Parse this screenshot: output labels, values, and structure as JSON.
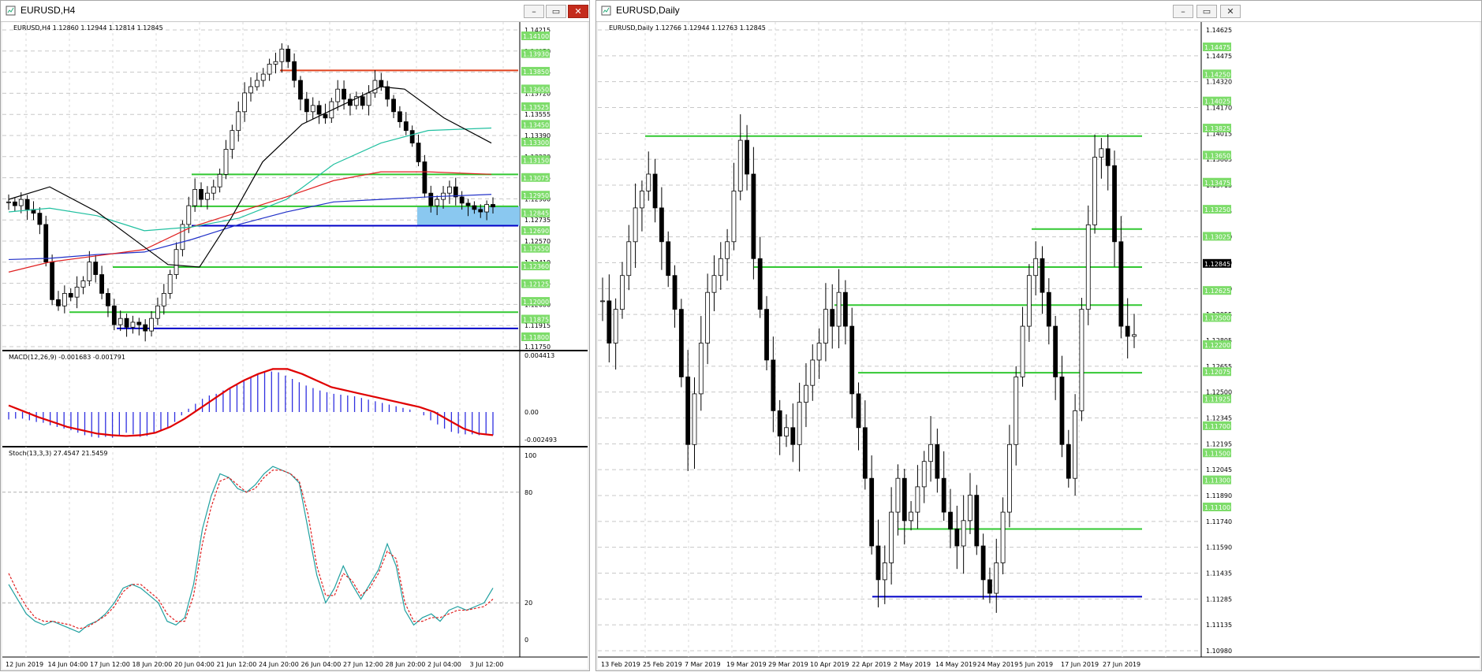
{
  "windows": {
    "h4": {
      "title": "EURUSD,H4",
      "header": "EURUSD,H4  1.12860 1.12944 1.12814 1.12845"
    },
    "daily": {
      "title": "EURUSD,Daily",
      "header": "EURUSD,Daily  1.12766 1.12944 1.12763 1.12845"
    }
  },
  "h4": {
    "price_ticks": [
      "1.14215",
      "1.14050",
      "1.13885",
      "1.13720",
      "1.13555",
      "1.13390",
      "1.13230",
      "1.13065",
      "1.12900",
      "1.12735",
      "1.12570",
      "1.12410",
      "1.12245",
      "1.12080",
      "1.11915",
      "1.11750"
    ],
    "level_labels": [
      {
        "text": "1.14100",
        "color": "#7ddc6a"
      },
      {
        "text": "1.13930",
        "color": "#7ddc6a"
      },
      {
        "text": "1.13850",
        "color": "#7ddc6a"
      },
      {
        "text": "1.13650",
        "color": "#7ddc6a"
      },
      {
        "text": "1.13525",
        "color": "#7ddc6a"
      },
      {
        "text": "1.13450",
        "color": "#7ddc6a"
      },
      {
        "text": "1.13300",
        "color": "#7ddc6a"
      },
      {
        "text": "1.13150",
        "color": "#7ddc6a"
      },
      {
        "text": "1.13075",
        "color": "#7ddc6a"
      },
      {
        "text": "1.12950",
        "color": "#7ddc6a"
      },
      {
        "text": "1.12845",
        "color": "#7ddc6a"
      },
      {
        "text": "1.12690",
        "color": "#7ddc6a"
      },
      {
        "text": "1.12550",
        "color": "#7ddc6a"
      },
      {
        "text": "1.12360",
        "color": "#7ddc6a"
      },
      {
        "text": "1.12125",
        "color": "#7ddc6a"
      },
      {
        "text": "1.12000",
        "color": "#7ddc6a"
      },
      {
        "text": "1.11875",
        "color": "#7ddc6a"
      },
      {
        "text": "1.11800",
        "color": "#7ddc6a"
      }
    ],
    "macd_label": "MACD(12,26,9) -0.001683 -0.001791",
    "macd_ticks": [
      "0.004413",
      "0.00",
      "-0.002493"
    ],
    "stoch_label": "Stoch(13,3,3) 27.4547 21.5459",
    "stoch_ticks": [
      "100",
      "80",
      "20",
      "0"
    ],
    "time_ticks": [
      "12 Jun 2019",
      "14 Jun 04:00",
      "17 Jun 12:00",
      "18 Jun 20:00",
      "20 Jun 04:00",
      "21 Jun 12:00",
      "24 Jun 20:00",
      "26 Jun 04:00",
      "27 Jun 12:00",
      "28 Jun 20:00",
      "2 Jul 04:00",
      "3 Jul 12:00"
    ]
  },
  "daily": {
    "price_ticks": [
      "1.14625",
      "1.14475",
      "1.14320",
      "1.14170",
      "1.14015",
      "1.13865",
      "1.13715",
      "1.13565",
      "1.13410",
      "1.13260",
      "1.13110",
      "1.12955",
      "1.12805",
      "1.12655",
      "1.12500",
      "1.12345",
      "1.12195",
      "1.12045",
      "1.11890",
      "1.11740",
      "1.11590",
      "1.11435",
      "1.11285",
      "1.11135",
      "1.10980"
    ],
    "level_labels": [
      {
        "text": "1.14475",
        "color": "#7ddc6a"
      },
      {
        "text": "1.14250",
        "color": "#7ddc6a"
      },
      {
        "text": "1.14025",
        "color": "#7ddc6a"
      },
      {
        "text": "1.13825",
        "color": "#7ddc6a"
      },
      {
        "text": "1.13650",
        "color": "#7ddc6a"
      },
      {
        "text": "1.13475",
        "color": "#7ddc6a"
      },
      {
        "text": "1.13250",
        "color": "#7ddc6a"
      },
      {
        "text": "1.13025",
        "color": "#7ddc6a"
      },
      {
        "text": "1.12845",
        "color": "#000000"
      },
      {
        "text": "1.12625",
        "color": "#7ddc6a"
      },
      {
        "text": "1.12500",
        "color": "#7ddc6a"
      },
      {
        "text": "1.12200",
        "color": "#7ddc6a"
      },
      {
        "text": "1.12075",
        "color": "#7ddc6a"
      },
      {
        "text": "1.11925",
        "color": "#7ddc6a"
      },
      {
        "text": "1.11700",
        "color": "#7ddc6a"
      },
      {
        "text": "1.11500",
        "color": "#7ddc6a"
      },
      {
        "text": "1.11300",
        "color": "#7ddc6a"
      },
      {
        "text": "1.11100",
        "color": "#7ddc6a"
      }
    ],
    "time_ticks": [
      "13 Feb 2019",
      "25 Feb 2019",
      "7 Mar 2019",
      "19 Mar 2019",
      "29 Mar 2019",
      "10 Apr 2019",
      "22 Apr 2019",
      "2 May 2019",
      "14 May 2019",
      "24 May 2019",
      "5 Jun 2019",
      "17 Jun 2019",
      "27 Jun 2019"
    ]
  },
  "colors": {
    "bull": "#ffffff",
    "bear": "#000000",
    "green_level": "#32c832",
    "blue_level": "#0000c8",
    "red_level": "#e0401c",
    "ma_red": "#e02020",
    "ma_blue": "#2030c8",
    "ma_black": "#000000",
    "ma_aqua": "#20c0a0",
    "macd_hist": "#3030e0",
    "macd_signal": "#e00000",
    "zone": "#8ac8f0"
  },
  "buttons": {
    "min": "–",
    "max": "▭",
    "close": "✕"
  }
}
